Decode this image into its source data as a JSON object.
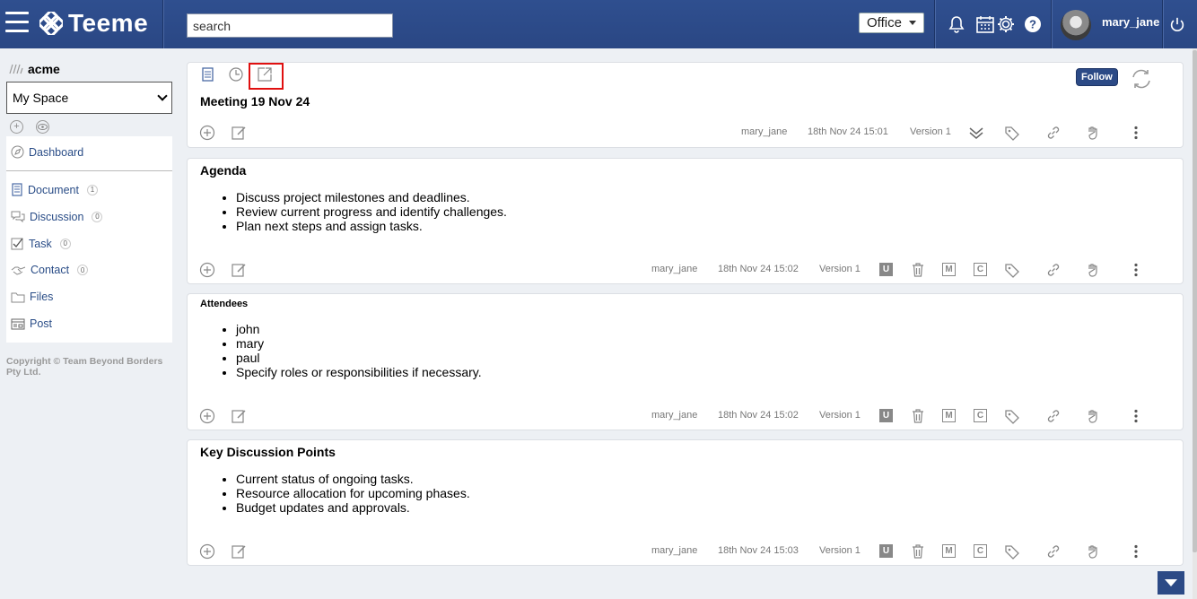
{
  "topbar": {
    "app_name": "Teeme",
    "search_placeholder": "search",
    "office_label": "Office",
    "username": "mary_jane"
  },
  "sidebar": {
    "org_name": "acme",
    "space_selected": "My Space",
    "nav": [
      {
        "label": "Dashboard"
      },
      {
        "label": "Document",
        "count": "1"
      },
      {
        "label": "Discussion",
        "count": "0"
      },
      {
        "label": "Task",
        "count": "0"
      },
      {
        "label": "Contact",
        "count": "0"
      },
      {
        "label": "Files"
      },
      {
        "label": "Post"
      }
    ],
    "copyright": "Copyright © Team Beyond Borders Pty Ltd."
  },
  "document": {
    "title": "Meeting 19 Nov 24",
    "follow_label": "Follow",
    "author": "mary_jane",
    "timestamp": "18th Nov 24 15:01",
    "version": "Version 1"
  },
  "sections": [
    {
      "title": "Agenda",
      "items": [
        "Discuss project milestones and deadlines.",
        "Review current progress and identify challenges.",
        "Plan next steps and assign tasks."
      ],
      "author": "mary_jane",
      "timestamp": "18th Nov 24 15:02",
      "version": "Version 1"
    },
    {
      "title": "Attendees",
      "items": [
        "john",
        "mary",
        "paul",
        "Specify roles or responsibilities if necessary."
      ],
      "author": "mary_jane",
      "timestamp": "18th Nov 24 15:02",
      "version": "Version 1"
    },
    {
      "title": "Key Discussion Points",
      "items": [
        "Current status of ongoing tasks.",
        "Resource allocation for upcoming phases.",
        "Budget updates and approvals."
      ],
      "author": "mary_jane",
      "timestamp": "18th Nov 24 15:03",
      "version": "Version 1"
    }
  ],
  "badges": {
    "u": "U",
    "m": "M",
    "c": "C"
  }
}
